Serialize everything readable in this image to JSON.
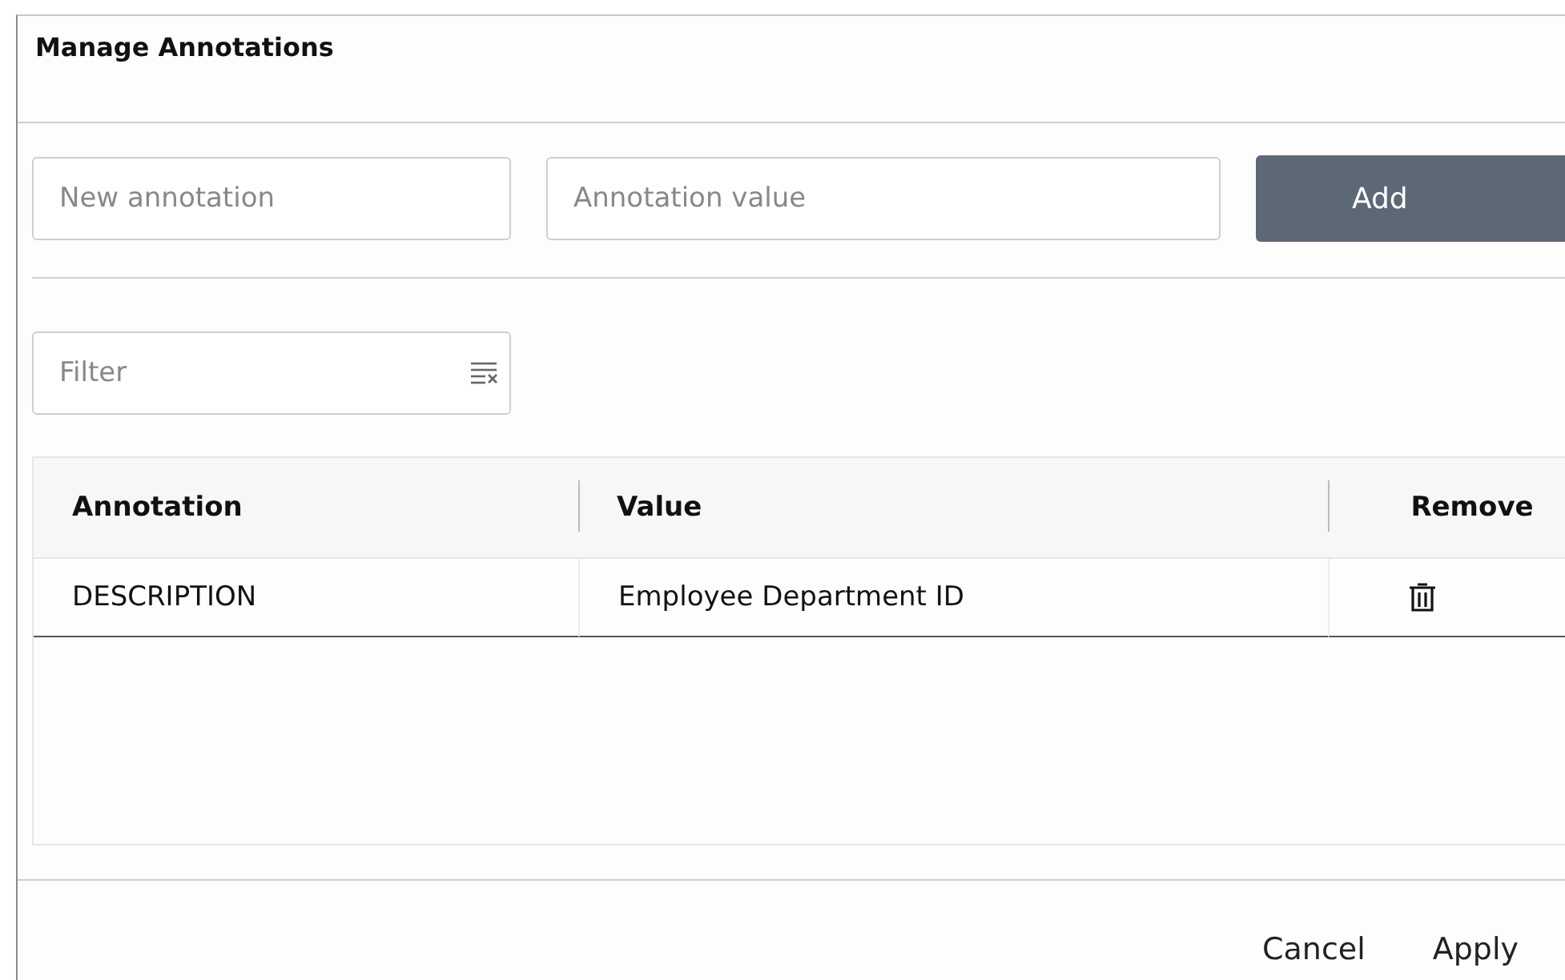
{
  "dialog": {
    "title": "Manage Annotations"
  },
  "new_annotation": {
    "placeholder": "New annotation"
  },
  "annotation_value": {
    "placeholder": "Annotation value"
  },
  "add_button": "Add",
  "filter": {
    "placeholder": "Filter"
  },
  "table": {
    "columns": [
      "Annotation",
      "Value",
      "Remove"
    ],
    "rows": [
      {
        "annotation": "DESCRIPTION",
        "value": "Employee Department ID"
      }
    ]
  },
  "footer_buttons": [
    "Cancel",
    "Apply"
  ]
}
